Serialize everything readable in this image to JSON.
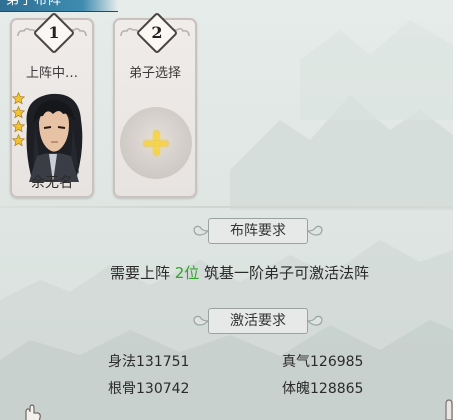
{
  "header": {
    "title": "弟子布阵"
  },
  "slots": [
    {
      "number": "1",
      "status": "上阵中…",
      "character_name": "余无名",
      "stars": 4
    },
    {
      "number": "2",
      "status": "弟子选择",
      "action": "add"
    }
  ],
  "formation": {
    "header": "布阵要求",
    "requirement_prefix": "需要上阵 ",
    "requirement_count": "2位",
    "requirement_suffix": " 筑基一阶弟子可激活法阵"
  },
  "activation": {
    "header": "激活要求",
    "stats": [
      {
        "label": "身法131751"
      },
      {
        "label": "真气126985"
      },
      {
        "label": "根骨130742"
      },
      {
        "label": "体魄128865"
      }
    ]
  },
  "colors": {
    "highlight": "#2fa32a",
    "ribbon": "#3e8cb0",
    "plus": "#f6d34a",
    "star": "#f2c230"
  },
  "icons": [
    "star-icon",
    "plus-icon",
    "hand-pointer-icon",
    "cloud-ornament-icon"
  ]
}
